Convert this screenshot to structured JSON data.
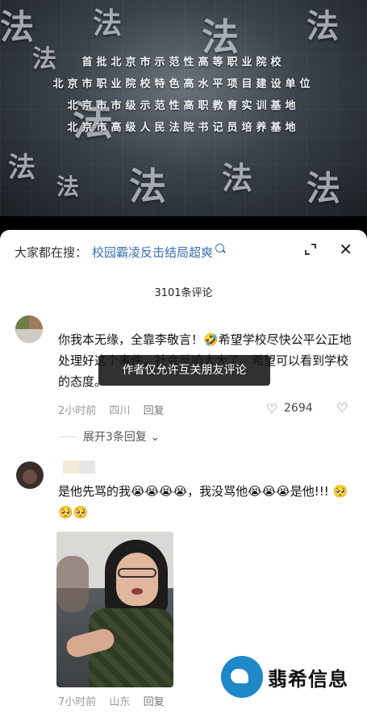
{
  "video": {
    "lines": [
      "首批北京市示范性高等职业院校",
      "北京市职业院校特色高水平项目建设单位",
      "北京市市级示范性高职教育实训基地",
      "北京市高级人民法院书记员培养基地"
    ]
  },
  "sheet": {
    "search_prefix": "大家都在搜：",
    "search_term": "校园霸凌反击结局超爽",
    "comment_count": "3101条评论",
    "toast": "作者仅允许互关朋友评论"
  },
  "comments": [
    {
      "text": "你我本无缘，全靠李敬言！🤣希望学校尽快公平公正地处理好这个事件，社会反响太大了。希望可以看到学校的态度。",
      "time": "2小时前",
      "location": "四川",
      "reply_label": "回复",
      "likes": "2694",
      "expand_label": "展开3条回复"
    },
    {
      "text": "是他先骂的我😭😭😭😭，我没骂他😭😭😭是他!!! 🥺🥺🥺",
      "time": "7小时前",
      "location": "山东",
      "reply_label": "回复"
    }
  ],
  "watermark": {
    "text": "翡希信息"
  }
}
